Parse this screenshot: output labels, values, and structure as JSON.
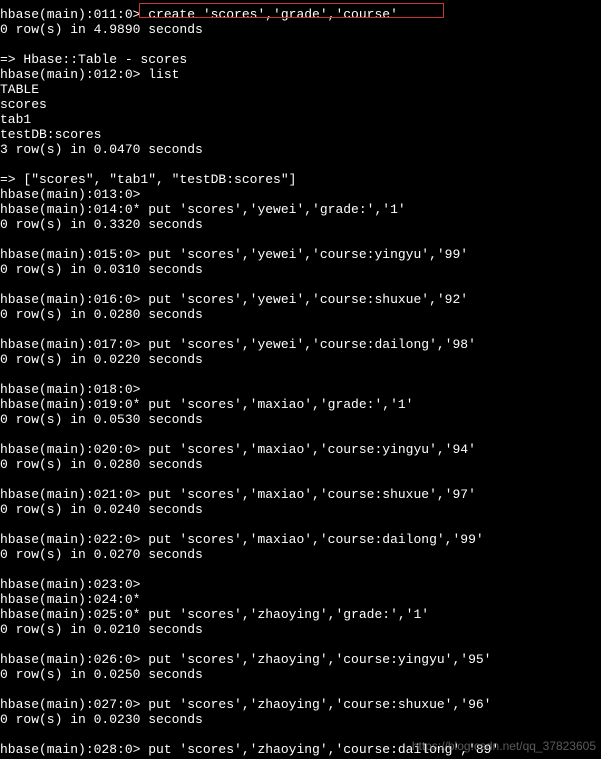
{
  "lines": [
    "hbase(main):011:0> create 'scores','grade','course'",
    "0 row(s) in 4.9890 seconds",
    "",
    "=> Hbase::Table - scores",
    "hbase(main):012:0> list",
    "TABLE",
    "scores",
    "tab1",
    "testDB:scores",
    "3 row(s) in 0.0470 seconds",
    "",
    "=> [\"scores\", \"tab1\", \"testDB:scores\"]",
    "hbase(main):013:0>",
    "hbase(main):014:0* put 'scores','yewei','grade:','1'",
    "0 row(s) in 0.3320 seconds",
    "",
    "hbase(main):015:0> put 'scores','yewei','course:yingyu','99'",
    "0 row(s) in 0.0310 seconds",
    "",
    "hbase(main):016:0> put 'scores','yewei','course:shuxue','92'",
    "0 row(s) in 0.0280 seconds",
    "",
    "hbase(main):017:0> put 'scores','yewei','course:dailong','98'",
    "0 row(s) in 0.0220 seconds",
    "",
    "hbase(main):018:0>",
    "hbase(main):019:0* put 'scores','maxiao','grade:','1'",
    "0 row(s) in 0.0530 seconds",
    "",
    "hbase(main):020:0> put 'scores','maxiao','course:yingyu','94'",
    "0 row(s) in 0.0280 seconds",
    "",
    "hbase(main):021:0> put 'scores','maxiao','course:shuxue','97'",
    "0 row(s) in 0.0240 seconds",
    "",
    "hbase(main):022:0> put 'scores','maxiao','course:dailong','99'",
    "0 row(s) in 0.0270 seconds",
    "",
    "hbase(main):023:0>",
    "hbase(main):024:0*",
    "hbase(main):025:0* put 'scores','zhaoying','grade:','1'",
    "0 row(s) in 0.0210 seconds",
    "",
    "hbase(main):026:0> put 'scores','zhaoying','course:yingyu','95'",
    "0 row(s) in 0.0250 seconds",
    "",
    "hbase(main):027:0> put 'scores','zhaoying','course:shuxue','96'",
    "0 row(s) in 0.0230 seconds",
    "",
    "hbase(main):028:0> put 'scores','zhaoying','course:dailong','89'"
  ],
  "watermark": "https://blog.csdn.net/qq_37823605"
}
